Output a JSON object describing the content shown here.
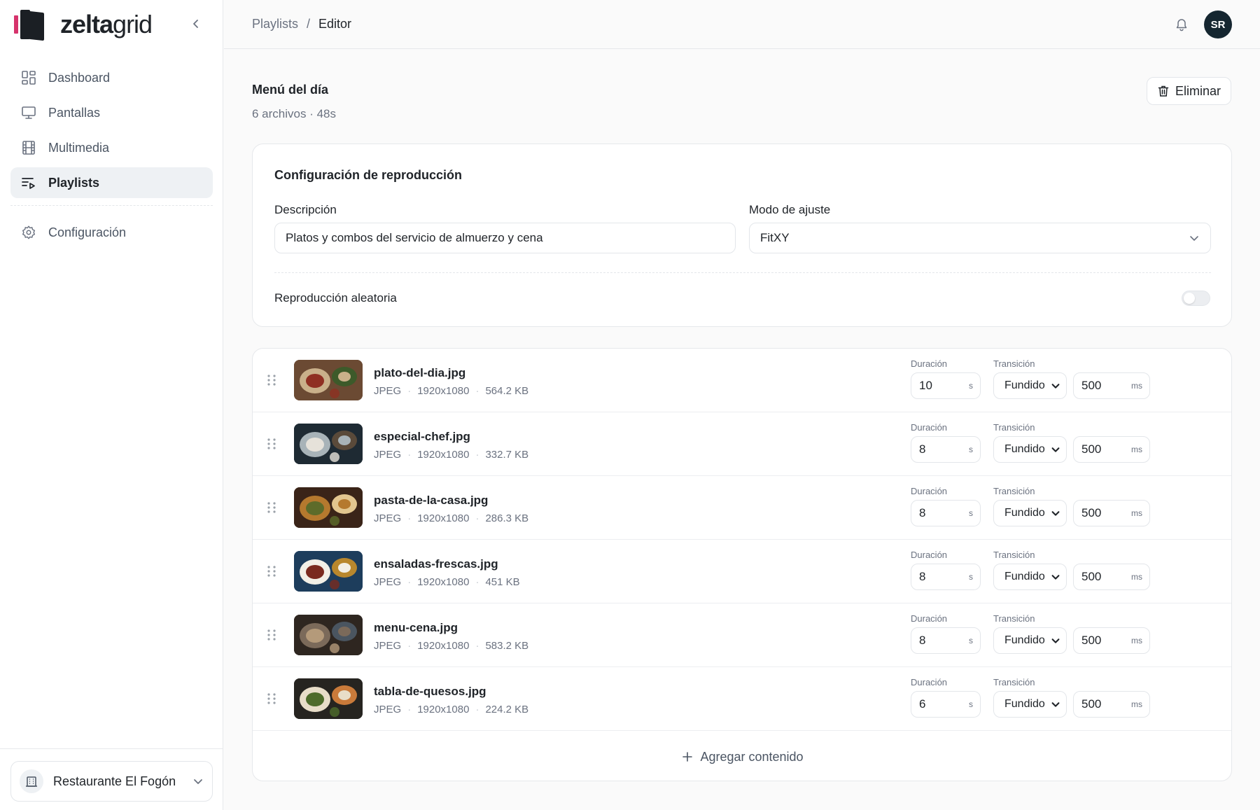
{
  "brand": {
    "name_bold": "zelta",
    "name_light": "grid"
  },
  "nav": {
    "items": [
      {
        "label": "Dashboard",
        "icon": "dashboard-icon"
      },
      {
        "label": "Pantallas",
        "icon": "monitor-icon"
      },
      {
        "label": "Multimedia",
        "icon": "film-icon"
      },
      {
        "label": "Playlists",
        "icon": "playlist-icon",
        "active": true
      }
    ],
    "settings": {
      "label": "Configuración",
      "icon": "gear-icon"
    }
  },
  "org": {
    "name": "Restaurante El Fogón"
  },
  "header": {
    "breadcrumb": [
      "Playlists",
      "/",
      "Editor"
    ],
    "avatar_initials": "SR"
  },
  "playlist": {
    "title": "Menú del día",
    "subtitle": "6 archivos · 48s",
    "delete_label": "Eliminar"
  },
  "config": {
    "title": "Configuración de reproducción",
    "description_label": "Descripción",
    "description_value": "Platos y combos del servicio de almuerzo y cena",
    "fit_label": "Modo de ajuste",
    "fit_value": "FitXY",
    "shuffle_label": "Reproducción aleatoria",
    "shuffle_on": false
  },
  "labels": {
    "duration": "Duración",
    "transition": "Transición",
    "seconds_unit": "s",
    "ms_unit": "ms",
    "add_content": "Agregar contenido"
  },
  "items": [
    {
      "name": "plato-del-dia.jpg",
      "type": "JPEG",
      "resolution": "1920x1080",
      "size": "564.2 KB",
      "duration": "10",
      "transition": "Fundido",
      "transition_ms": "500"
    },
    {
      "name": "especial-chef.jpg",
      "type": "JPEG",
      "resolution": "1920x1080",
      "size": "332.7 KB",
      "duration": "8",
      "transition": "Fundido",
      "transition_ms": "500"
    },
    {
      "name": "pasta-de-la-casa.jpg",
      "type": "JPEG",
      "resolution": "1920x1080",
      "size": "286.3 KB",
      "duration": "8",
      "transition": "Fundido",
      "transition_ms": "500"
    },
    {
      "name": "ensaladas-frescas.jpg",
      "type": "JPEG",
      "resolution": "1920x1080",
      "size": "451 KB",
      "duration": "8",
      "transition": "Fundido",
      "transition_ms": "500"
    },
    {
      "name": "menu-cena.jpg",
      "type": "JPEG",
      "resolution": "1920x1080",
      "size": "583.2 KB",
      "duration": "8",
      "transition": "Fundido",
      "transition_ms": "500"
    },
    {
      "name": "tabla-de-quesos.jpg",
      "type": "JPEG",
      "resolution": "1920x1080",
      "size": "224.2 KB",
      "duration": "6",
      "transition": "Fundido",
      "transition_ms": "500"
    }
  ],
  "colors": {
    "brand_accent": "#d6336c",
    "dark": "#152630",
    "active_nav_bg": "#eef1f4"
  }
}
